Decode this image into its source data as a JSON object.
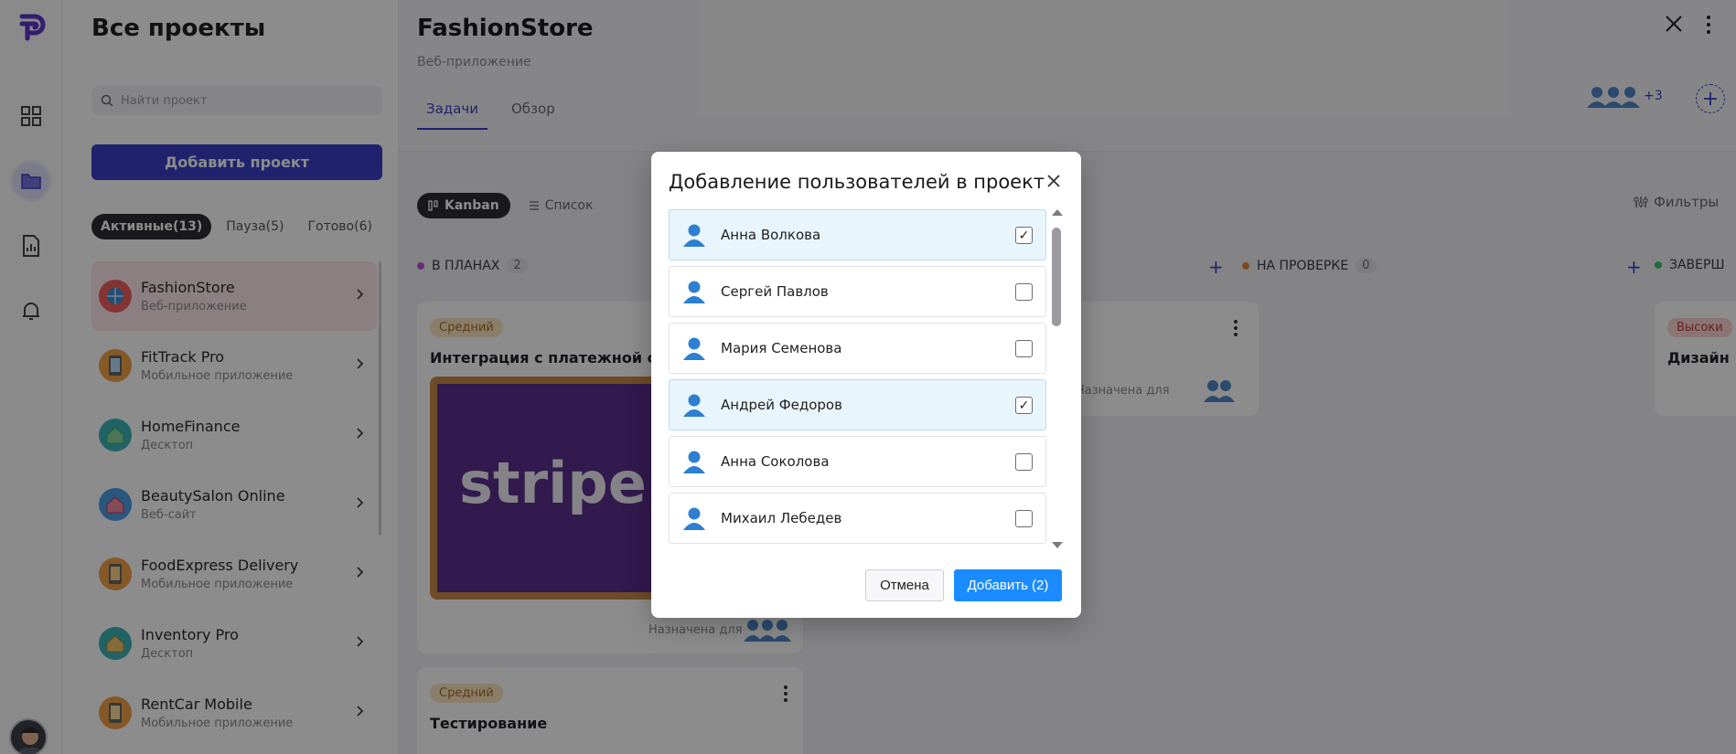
{
  "sidebar": {
    "title": "Все проекты",
    "search_placeholder": "Найти проект",
    "add_project": "Добавить проект",
    "filters": [
      {
        "label": "Активные(13)",
        "active": true
      },
      {
        "label": "Пауза(5)",
        "active": false
      },
      {
        "label": "Готово(6)",
        "active": false
      }
    ],
    "projects": [
      {
        "name": "FashionStore",
        "type": "Веб-приложение",
        "active": true
      },
      {
        "name": "FitTrack Pro",
        "type": "Мобильное приложение"
      },
      {
        "name": "HomeFinance",
        "type": "Десктоп"
      },
      {
        "name": "BeautySalon Online",
        "type": "Веб-сайт"
      },
      {
        "name": "FoodExpress Delivery",
        "type": "Мобильное приложение"
      },
      {
        "name": "Inventory Pro",
        "type": "Десктоп"
      },
      {
        "name": "RentCar Mobile",
        "type": "Мобильное приложение"
      }
    ]
  },
  "header": {
    "title": "FashionStore",
    "subtitle": "Веб-приложение",
    "tabs": [
      {
        "label": "Задачи",
        "active": true
      },
      {
        "label": "Обзор",
        "active": false
      }
    ],
    "members_more": "+3"
  },
  "board": {
    "views": [
      {
        "label": "Kanban",
        "active": true
      },
      {
        "label": "Список",
        "active": false
      }
    ],
    "filters_label": "Фильтры",
    "columns": [
      {
        "label": "В ПЛАНАХ",
        "count": "2",
        "color": "#c04fd8"
      },
      {
        "label": "НА ПРОВЕРКЕ",
        "count": "0",
        "color": "#e8833a"
      },
      {
        "label": "ЗАВЕРШ",
        "count": "",
        "color": "#3cc46a"
      }
    ],
    "cards": [
      {
        "priority": "Средний",
        "title": "Интеграция с платежной сис",
        "image_text": "stripe",
        "assigned": "Назначена для"
      },
      {
        "priority": "Средний",
        "title": "Тестирование"
      },
      {
        "assigned": "Назначена для"
      },
      {
        "priority": "Высоки",
        "title": "Дизайн"
      }
    ]
  },
  "modal": {
    "title": "Добавление пользователей в проект",
    "users": [
      {
        "name": "Анна Волкова",
        "checked": true
      },
      {
        "name": "Сергей Павлов",
        "checked": false
      },
      {
        "name": "Мария Семенова",
        "checked": false
      },
      {
        "name": "Андрей Федоров",
        "checked": true
      },
      {
        "name": "Анна Соколова",
        "checked": false
      },
      {
        "name": "Михаил Лебедев",
        "checked": false
      }
    ],
    "cancel": "Отмена",
    "add": "Добавить (2)"
  },
  "colors": {
    "brand": "#3b3ec8",
    "primary_button": "#1a8cff",
    "selected_row": "#e8f5fd"
  }
}
